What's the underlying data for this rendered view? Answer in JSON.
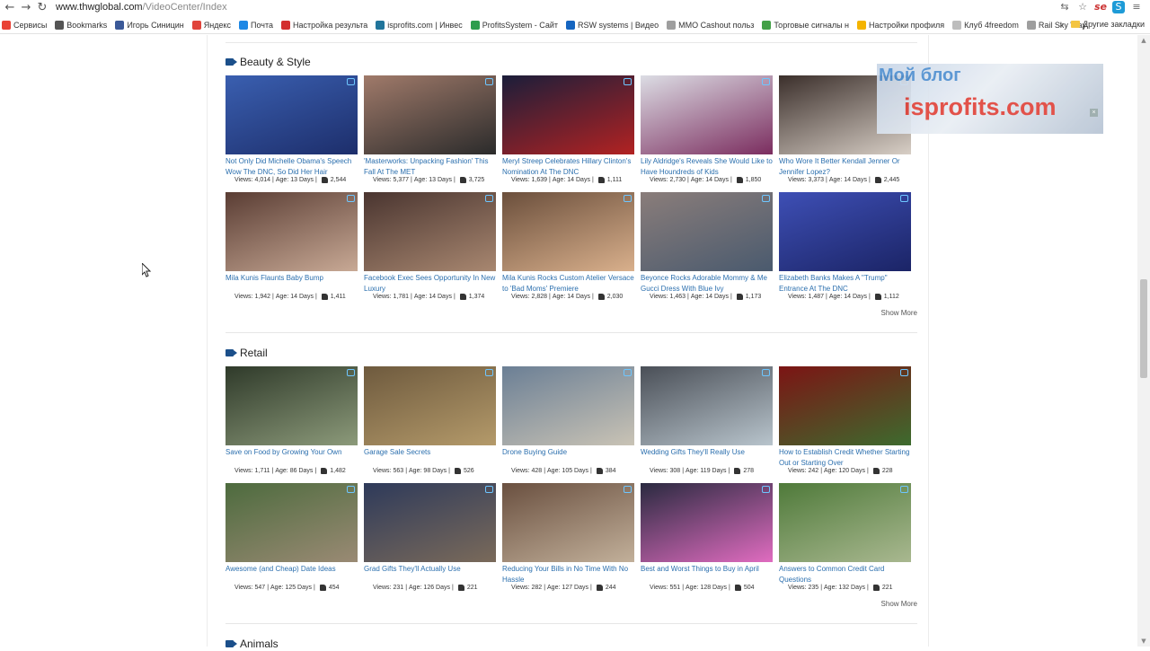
{
  "browser": {
    "url_domain": "www.thwglobal.com",
    "url_path": "/VideoCenter/Index",
    "back_icon": "←",
    "forward_icon": "→",
    "reload_icon": "↻"
  },
  "bookmarks": [
    {
      "label": "Сервисы",
      "icon": "apps-icon",
      "color": "#e94235"
    },
    {
      "label": "Bookmarks",
      "icon": "star-icon",
      "color": "#555555"
    },
    {
      "label": "Игорь Синицин",
      "icon": "facebook-icon",
      "color": "#3b5998"
    },
    {
      "label": "Яндекс",
      "icon": "yandex-icon",
      "color": "#e0443b"
    },
    {
      "label": "Почта",
      "icon": "mail-icon",
      "color": "#1e88e5"
    },
    {
      "label": "Настройка результа",
      "icon": "advert-icon",
      "color": "#d32f2f"
    },
    {
      "label": "isprofits.com | Инвес",
      "icon": "wordpress-icon",
      "color": "#21759b"
    },
    {
      "label": "ProfitsSystem - Сайт",
      "icon": "chart-icon",
      "color": "#2e9d4e"
    },
    {
      "label": "RSW systems | Видео",
      "icon": "rsw-icon",
      "color": "#1565c0"
    },
    {
      "label": "MMO Cashout польз",
      "icon": "page-icon",
      "color": "#9e9e9e"
    },
    {
      "label": "Торговые сигналы н",
      "icon": "signal-icon",
      "color": "#43a047"
    },
    {
      "label": "Настройки профиля",
      "icon": "profile-icon",
      "color": "#f4b400"
    },
    {
      "label": "Клуб 4freedom",
      "icon": "page-icon",
      "color": "#bdbdbd"
    },
    {
      "label": "Rail Sky Way",
      "icon": "page-icon",
      "color": "#9e9e9e"
    }
  ],
  "bookmarks_more": "»",
  "other_bookmarks": "Другие закладки",
  "watermark": {
    "line1": "Мой блог",
    "line2": "isprofits.com"
  },
  "sections": [
    {
      "title": "Beauty & Style",
      "show_more": "Show More",
      "videos": [
        {
          "title": "Not Only Did Michelle Obama's Speech Wow The DNC, So Did Her Hair",
          "views": "4,014",
          "age": "13 Days",
          "likes": "2,544",
          "thumb": [
            "#3a5fb0",
            "#1d2e6b"
          ]
        },
        {
          "title": "'Masterworks: Unpacking Fashion' This Fall At The MET",
          "views": "5,377",
          "age": "13 Days",
          "likes": "3,725",
          "thumb": [
            "#a07a6a",
            "#2b2b2b"
          ]
        },
        {
          "title": "Meryl Streep Celebrates Hillary Clinton's Nomination At The DNC",
          "views": "1,639",
          "age": "14 Days",
          "likes": "1,111",
          "thumb": [
            "#1b1e3a",
            "#b22222"
          ]
        },
        {
          "title": "Lily Aldridge's Reveals She Would Like to Have Houndreds of Kids",
          "views": "2,730",
          "age": "14 Days",
          "likes": "1,850",
          "thumb": [
            "#dcdde4",
            "#7b2d5f"
          ]
        },
        {
          "title": "Who Wore It Better Kendall Jenner Or Jennifer Lopez?",
          "views": "3,373",
          "age": "14 Days",
          "likes": "2,445",
          "thumb": [
            "#3b2f2b",
            "#d8cfc6"
          ]
        },
        {
          "title": "Mila Kunis Flaunts Baby Bump",
          "views": "1,942",
          "age": "14 Days",
          "likes": "1,411",
          "thumb": [
            "#5a3d34",
            "#c8a995"
          ]
        },
        {
          "title": "Facebook Exec Sees Opportunity In New Luxury",
          "views": "1,781",
          "age": "14 Days",
          "likes": "1,374",
          "thumb": [
            "#4a3530",
            "#a88770"
          ]
        },
        {
          "title": "Mila Kunis Rocks Custom Atelier Versace to 'Bad Moms' Premiere",
          "views": "2,828",
          "age": "14 Days",
          "likes": "2,030",
          "thumb": [
            "#6b4f3c",
            "#d9b08c"
          ]
        },
        {
          "title": "Beyonce Rocks Adorable Mommy & Me Gucci Dress With Blue Ivy",
          "views": "1,463",
          "age": "14 Days",
          "likes": "1,173",
          "thumb": [
            "#8a7d7a",
            "#4a5a6e"
          ]
        },
        {
          "title": "Elizabeth Banks Makes A \"Trump\" Entrance At The DNC",
          "views": "1,487",
          "age": "14 Days",
          "likes": "1,112",
          "thumb": [
            "#3e4fb5",
            "#1b2466"
          ]
        }
      ]
    },
    {
      "title": "Retail",
      "show_more": "Show More",
      "videos": [
        {
          "title": "Save on Food by Growing Your Own",
          "views": "1,711",
          "age": "86 Days",
          "likes": "1,482",
          "thumb": [
            "#2f3a2a",
            "#8c9a7a"
          ]
        },
        {
          "title": "Garage Sale Secrets",
          "views": "563",
          "age": "98 Days",
          "likes": "526",
          "thumb": [
            "#6e5a3e",
            "#b49a6a"
          ]
        },
        {
          "title": "Drone Buying Guide",
          "views": "428",
          "age": "105 Days",
          "likes": "384",
          "thumb": [
            "#6b7f95",
            "#c9c3b5"
          ]
        },
        {
          "title": "Wedding Gifts They'll Really Use",
          "views": "308",
          "age": "119 Days",
          "likes": "278",
          "thumb": [
            "#4a4f57",
            "#b8c4cc"
          ]
        },
        {
          "title": "How to Establish Credit Whether Starting Out or Starting Over",
          "views": "242",
          "age": "120 Days",
          "likes": "228",
          "thumb": [
            "#7c1414",
            "#3d6b2e"
          ]
        },
        {
          "title": "Awesome (and Cheap) Date Ideas",
          "views": "547",
          "age": "125 Days",
          "likes": "454",
          "thumb": [
            "#4d6b3e",
            "#9a8a74"
          ]
        },
        {
          "title": "Grad Gifts They'll Actually Use",
          "views": "231",
          "age": "126 Days",
          "likes": "221",
          "thumb": [
            "#2e3a5a",
            "#7a6a5a"
          ]
        },
        {
          "title": "Reducing Your Bills in No Time With No Hassle",
          "views": "282",
          "age": "127 Days",
          "likes": "244",
          "thumb": [
            "#6a5040",
            "#c2b09a"
          ]
        },
        {
          "title": "Best and Worst Things to Buy in April",
          "views": "551",
          "age": "128 Days",
          "likes": "504",
          "thumb": [
            "#2a2a40",
            "#e06cc0"
          ]
        },
        {
          "title": "Answers to Common Credit Card Questions",
          "views": "235",
          "age": "132 Days",
          "likes": "221",
          "thumb": [
            "#4f7a3a",
            "#a9b890"
          ]
        }
      ]
    },
    {
      "title": "Animals",
      "show_more": "",
      "videos": []
    }
  ],
  "meta_labels": {
    "views": "Views:",
    "age": "Age:",
    "sep": "|"
  }
}
